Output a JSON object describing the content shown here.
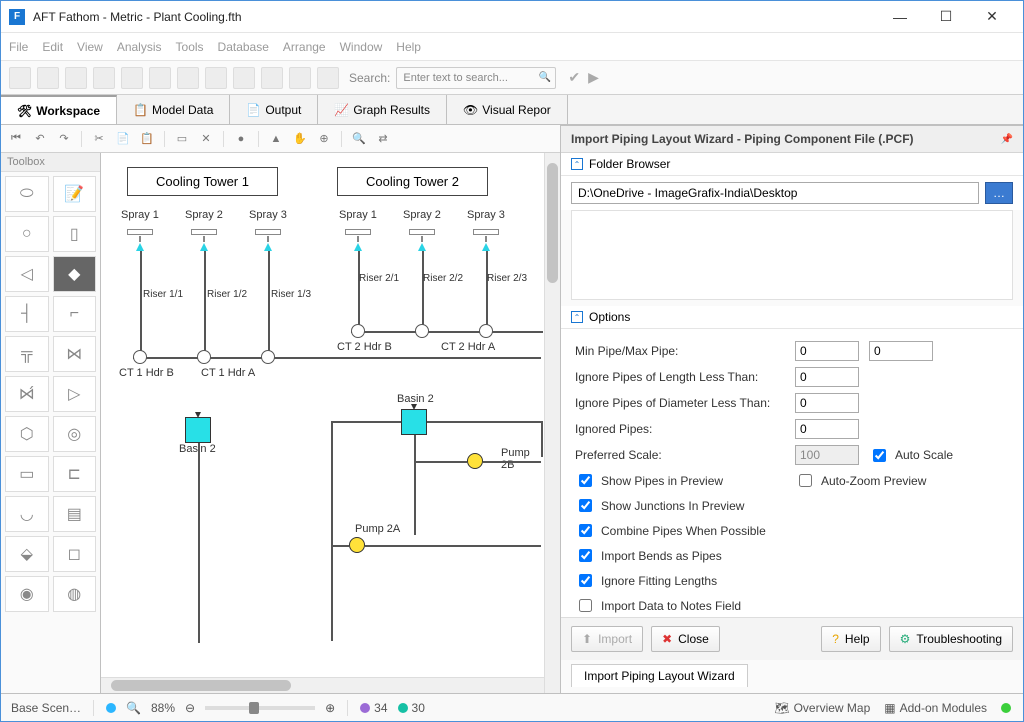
{
  "title": "AFT Fathom - Metric - Plant Cooling.fth",
  "menu": {
    "file": "File",
    "edit": "Edit",
    "view": "View",
    "analysis": "Analysis",
    "tools": "Tools",
    "database": "Database",
    "arrange": "Arrange",
    "window": "Window",
    "help": "Help"
  },
  "toolbar": {
    "search_label": "Search:",
    "search_placeholder": "Enter text to search..."
  },
  "tabs": {
    "workspace": "Workspace",
    "model_data": "Model Data",
    "output": "Output",
    "graph_results": "Graph Results",
    "visual_report": "Visual Repor"
  },
  "toolbox_title": "Toolbox",
  "diagram": {
    "ct1": "Cooling Tower 1",
    "ct2": "Cooling Tower 2",
    "sprays": [
      "Spray 1",
      "Spray 2",
      "Spray 3",
      "Spray 1",
      "Spray 2",
      "Spray 3"
    ],
    "risers_l": [
      "Riser 1/1",
      "Riser 1/2",
      "Riser 1/3"
    ],
    "risers_r": [
      "Riser 2/1",
      "Riser 2/2",
      "Riser 2/3"
    ],
    "ct1_hdr_b": "CT 1 Hdr B",
    "ct1_hdr_a": "CT 1 Hdr A",
    "ct2_hdr_b": "CT 2 Hdr B",
    "ct2_hdr_a": "CT 2 Hdr A",
    "basin2a": "Basin 2",
    "basin2b": "Basin 2",
    "pump2a": "Pump 2A",
    "pump2b": "Pump 2B"
  },
  "wizard": {
    "title": "Import Piping Layout Wizard - Piping Component File (.PCF)",
    "folder_browser": "Folder Browser",
    "path": "D:\\OneDrive - ImageGrafix-India\\Desktop",
    "options": "Options",
    "min_max_pipe": "Min Pipe/Max Pipe:",
    "min_pipe_val": "0",
    "max_pipe_val": "0",
    "ignore_len": "Ignore Pipes of Length Less Than:",
    "ignore_len_val": "0",
    "ignore_dia": "Ignore Pipes of Diameter Less Than:",
    "ignore_dia_val": "0",
    "ignored_pipes": "Ignored Pipes:",
    "ignored_pipes_val": "0",
    "preferred_scale": "Preferred Scale:",
    "preferred_scale_val": "100",
    "auto_scale": "Auto Scale",
    "show_pipes": "Show Pipes in Preview",
    "auto_zoom": "Auto-Zoom Preview",
    "show_junctions": "Show Junctions In Preview",
    "combine_pipes": "Combine Pipes When Possible",
    "import_bends": "Import Bends as Pipes",
    "ignore_fitting": "Ignore Fitting Lengths",
    "import_notes": "Import Data to Notes Field",
    "btn_import": "Import",
    "btn_close": "Close",
    "btn_help": "Help",
    "btn_troubleshoot": "Troubleshooting",
    "wizard_tab": "Import Piping Layout Wizard"
  },
  "status": {
    "base_scen": "Base Scen…",
    "zoom": "88%",
    "count1": "34",
    "count2": "30",
    "overview_map": "Overview Map",
    "addon_modules": "Add-on Modules"
  }
}
